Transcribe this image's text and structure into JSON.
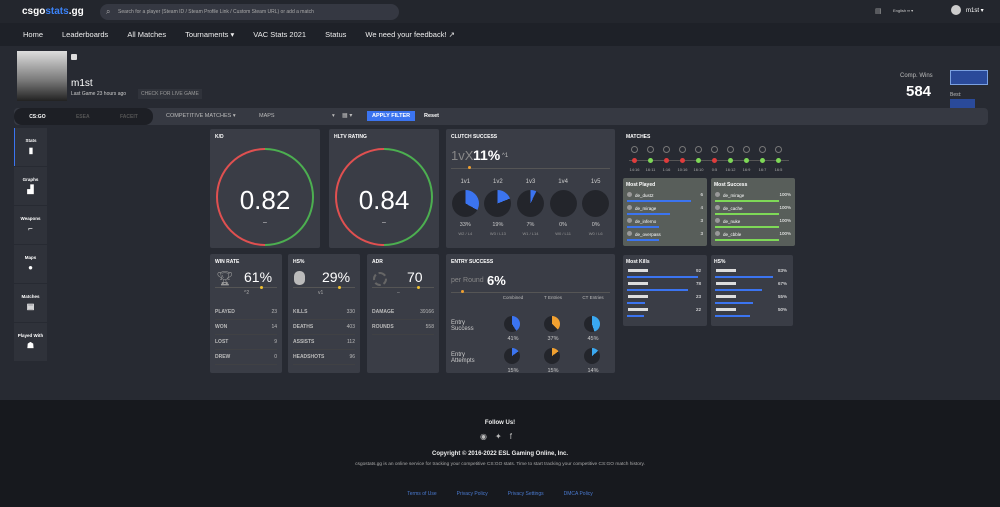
{
  "header": {
    "logo_a": "csgo",
    "logo_b": "stats",
    "logo_c": ".gg",
    "search_placeholder": "Search for a player (Steam ID / Steam Profile Link / Custom Steam URL) or add a match",
    "language": "English",
    "user": "m1st"
  },
  "nav": [
    "Home",
    "Leaderboards",
    "All Matches",
    "Tournaments ▾",
    "VAC Stats 2021",
    "Status",
    "We need your feedback! ↗"
  ],
  "profile": {
    "name": "m1st",
    "last_game": "Last Game 23 hours ago",
    "live_btn": "CHECK FOR LIVE GAME",
    "comp_wins_label": "Comp. Wins",
    "comp_wins": "584",
    "best_label": "Best:"
  },
  "filter": {
    "sources": [
      "CS:GO",
      "ESEA",
      "FACEIT"
    ],
    "mode": "COMPETITIVE MATCHES",
    "maps": "MAPS",
    "apply": "APPLY FILTER",
    "reset": "Reset"
  },
  "sidebar": [
    "Stats",
    "Graphs",
    "Weapons",
    "Maps",
    "Matches",
    "Played With"
  ],
  "kd": {
    "title": "K/D",
    "value": "0.82",
    "delta": "–"
  },
  "hltv": {
    "title": "HLTV RATING",
    "value": "0.84",
    "delta": "–"
  },
  "clutch": {
    "title": "CLUTCH SUCCESS",
    "prefix": "1vX",
    "value": "11%",
    "delta": "^1",
    "items": [
      {
        "label": "1v1",
        "pct": "33%",
        "wl": "W2 / L4",
        "v": 33
      },
      {
        "label": "1v2",
        "pct": "19%",
        "wl": "W3 / L13",
        "v": 19
      },
      {
        "label": "1v3",
        "pct": "7%",
        "wl": "W1 / L14",
        "v": 7
      },
      {
        "label": "1v4",
        "pct": "0%",
        "wl": "W0 / L11",
        "v": 0
      },
      {
        "label": "1v5",
        "pct": "0%",
        "wl": "W0 / L6",
        "v": 0
      }
    ]
  },
  "winrate": {
    "title": "WIN RATE",
    "value": "61%",
    "delta": "^2",
    "rows": [
      [
        "PLAYED",
        "23"
      ],
      [
        "WON",
        "14"
      ],
      [
        "LOST",
        "9"
      ],
      [
        "DREW",
        "0"
      ]
    ]
  },
  "hs": {
    "title": "HS%",
    "value": "29%",
    "delta": "v1",
    "rows": [
      [
        "KILLS",
        "330"
      ],
      [
        "DEATHS",
        "403"
      ],
      [
        "ASSISTS",
        "112"
      ],
      [
        "HEADSHOTS",
        "96"
      ]
    ]
  },
  "adr": {
    "title": "ADR",
    "value": "70",
    "delta": "–",
    "rows": [
      [
        "DAMAGE",
        "39166"
      ],
      [
        "ROUNDS",
        "558"
      ]
    ]
  },
  "entry": {
    "title": "ENTRY SUCCESS",
    "prefix": "per Round",
    "value": "6%",
    "cols": [
      "Combined",
      "T Entries",
      "CT Entries"
    ],
    "rows": [
      {
        "label": "Entry Success",
        "vals": [
          {
            "t": "41%",
            "v": 41
          },
          {
            "t": "37%",
            "v": 37
          },
          {
            "t": "45%",
            "v": 45
          }
        ]
      },
      {
        "label": "Entry Attempts",
        "vals": [
          {
            "t": "15%",
            "v": 15
          },
          {
            "t": "15%",
            "v": 15
          },
          {
            "t": "14%",
            "v": 14
          }
        ]
      }
    ]
  },
  "colors": {
    "blue": "#3b74f0",
    "orange": "#f0a030",
    "cyan": "#3aa8f0",
    "win": "#7ed957",
    "loss": "#e03c3c"
  },
  "matches": {
    "title": "MATCHES",
    "scores": [
      {
        "s": "14:16",
        "w": false
      },
      {
        "s": "16:11",
        "w": true
      },
      {
        "s": "1:16",
        "w": false
      },
      {
        "s": "10:16",
        "w": false
      },
      {
        "s": "16:10",
        "w": true
      },
      {
        "s": "0:5",
        "w": false
      },
      {
        "s": "16:12",
        "w": true
      },
      {
        "s": "16:9",
        "w": true
      },
      {
        "s": "16:7",
        "w": true
      },
      {
        "s": "16:5",
        "w": true
      }
    ]
  },
  "most_played": {
    "title": "Most Played",
    "items": [
      [
        "de_dust2",
        "6",
        100
      ],
      [
        "de_mirage",
        "4",
        67
      ],
      [
        "de_inferno",
        "3",
        50
      ],
      [
        "de_overpass",
        "3",
        50
      ]
    ]
  },
  "most_success": {
    "title": "Most Success",
    "items": [
      [
        "de_mirage",
        "100%",
        100
      ],
      [
        "de_cache",
        "100%",
        100
      ],
      [
        "de_nuke",
        "100%",
        100
      ],
      [
        "de_cbble",
        "100%",
        100
      ]
    ]
  },
  "most_kills": {
    "title": "Most Kills",
    "items": [
      [
        "92",
        100
      ],
      [
        "78",
        85
      ],
      [
        "23",
        25
      ],
      [
        "22",
        24
      ]
    ]
  },
  "hs_weapons": {
    "title": "HS%",
    "items": [
      [
        "83%",
        83
      ],
      [
        "67%",
        67
      ],
      [
        "55%",
        55
      ],
      [
        "50%",
        50
      ]
    ]
  },
  "footer": {
    "follow": "Follow Us!",
    "copyright": "Copyright © 2016-2022 ESL Gaming Online, Inc.",
    "desc": "csgostats.gg is an online service for tracking your competitive CS:GO stats. Time to start tracking your competitive CS:GO match history.",
    "links": [
      "Terms of Use",
      "Privacy Policy",
      "Privacy Settings",
      "DMCA Policy"
    ]
  }
}
